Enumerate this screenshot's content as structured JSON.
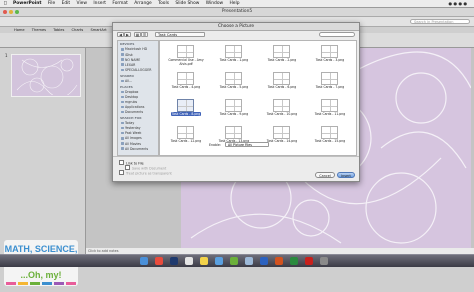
{
  "menubar": {
    "app": "PowerPoint",
    "items": [
      "File",
      "Edit",
      "View",
      "Insert",
      "Format",
      "Arrange",
      "Tools",
      "Slide Show",
      "Window",
      "Help"
    ]
  },
  "window": {
    "title": "Presentation5"
  },
  "toolbar": {
    "search_placeholder": "Search in Presentation"
  },
  "ribbon": {
    "tabs": [
      "Home",
      "Themes",
      "Tables",
      "Charts",
      "SmartArt",
      "Transitions",
      "Animations",
      "Slide Show",
      "Review"
    ]
  },
  "slides_panel": {
    "slide_number": "1"
  },
  "notes": {
    "placeholder": "Click to add notes"
  },
  "logo": {
    "line1": "MATH, SCIENCE,",
    "line2": "SOCIAL STUDIES",
    "line3": "...Oh, my!"
  },
  "dialog": {
    "title": "Choose a Picture",
    "location": "Task Cards",
    "sidebar": [
      {
        "header": "DEVICES",
        "items": [
          "Macintosh HD",
          "iDisk",
          "NO NAME",
          "LEXAR",
          "SPECIALLOGGER"
        ]
      },
      {
        "header": "SHARED",
        "items": [
          "All..."
        ]
      },
      {
        "header": "PLACES",
        "items": [
          "Dropbox",
          "Desktop",
          "mgrubs",
          "Applications",
          "Documents"
        ]
      },
      {
        "header": "SEARCH FOR",
        "items": [
          "Today",
          "Yesterday",
          "Past Week",
          "All Images",
          "All Movies",
          "All Documents"
        ]
      }
    ],
    "files": [
      {
        "name": "Commercial Use - Amy Alvis.pdf",
        "selected": false
      },
      {
        "name": "Task Cards - 1.png",
        "selected": false
      },
      {
        "name": "Task Cards - 2.png",
        "selected": false
      },
      {
        "name": "Task Cards - 3.png",
        "selected": false
      },
      {
        "name": "Task Cards - 4.png",
        "selected": false
      },
      {
        "name": "Task Cards - 5.png",
        "selected": false
      },
      {
        "name": "Task Cards - 6.png",
        "selected": false
      },
      {
        "name": "Task Cards - 7.png",
        "selected": false
      },
      {
        "name": "Task Cards - 8.png",
        "selected": true
      },
      {
        "name": "Task Cards - 9.png",
        "selected": false
      },
      {
        "name": "Task Cards - 10.png",
        "selected": false
      },
      {
        "name": "Task Cards - 11.png",
        "selected": false
      },
      {
        "name": "Task Cards - 12.png",
        "selected": false
      },
      {
        "name": "Task Cards - 13.png",
        "selected": false
      },
      {
        "name": "Task Cards - 14.png",
        "selected": false
      },
      {
        "name": "Task Cards - 15.png",
        "selected": false
      }
    ],
    "enable_label": "Enable:",
    "enable_value": "All Picture Files",
    "link_to_file": "Link to File",
    "save_with_document": "Save with Document",
    "transparent_option": "Treat picture as transparent",
    "cancel": "Cancel",
    "insert": "Insert"
  },
  "dock": [
    "Finder",
    "Chrome",
    "Photoshop",
    "Calendar",
    "Notes",
    "iTunes",
    "iPhoto",
    "Preview",
    "Word",
    "PowerPoint",
    "Excel",
    "Acrobat",
    "Trash"
  ]
}
